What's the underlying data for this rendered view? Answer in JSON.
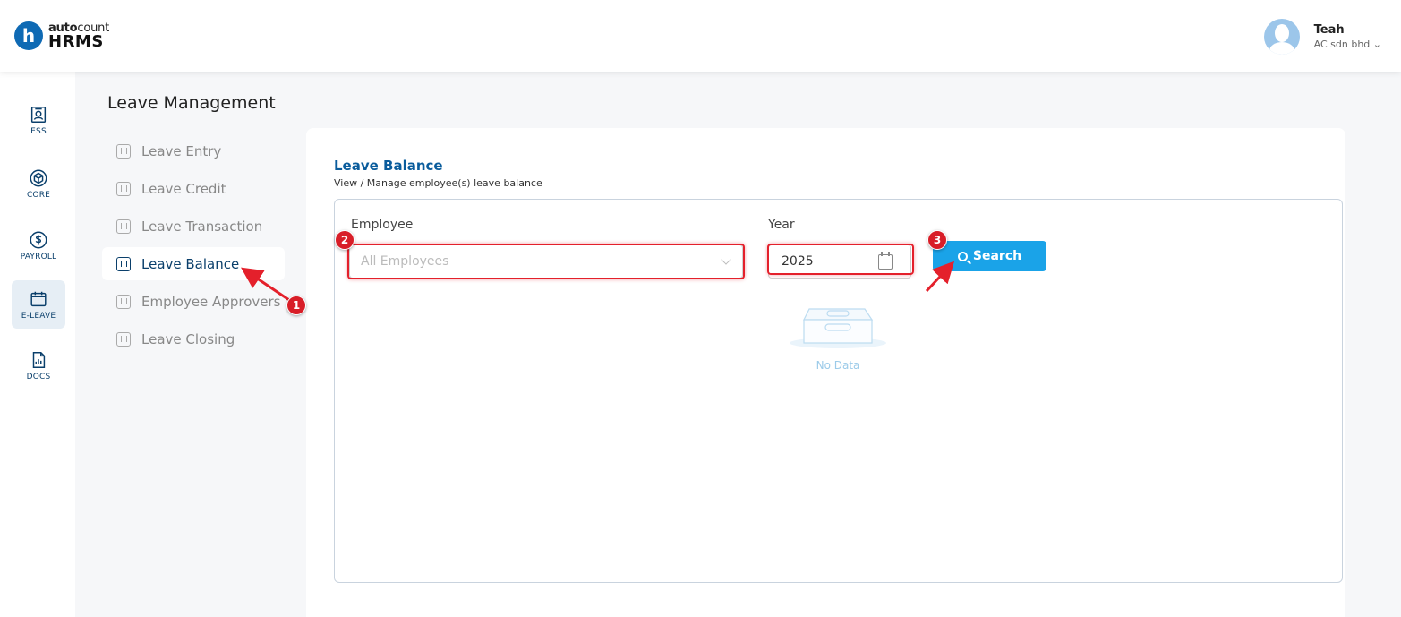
{
  "header": {
    "logo_letter": "h",
    "brand_prefix": "auto",
    "brand_suffix": "count",
    "product": "HRMS",
    "user_name": "Teah",
    "user_company": "AC sdn bhd ⌄"
  },
  "rail": [
    {
      "label": "ESS",
      "icon": "badge-icon"
    },
    {
      "label": "CORE",
      "icon": "cube-icon"
    },
    {
      "label": "PAYROLL",
      "icon": "dollar-icon"
    },
    {
      "label": "E-LEAVE",
      "icon": "calendar-icon",
      "active": true
    },
    {
      "label": "DOCS",
      "icon": "document-chart-icon"
    }
  ],
  "page_title": "Leave Management",
  "submenu": [
    {
      "label": "Leave Entry"
    },
    {
      "label": "Leave Credit"
    },
    {
      "label": "Leave Transaction"
    },
    {
      "label": "Leave Balance",
      "active": true
    },
    {
      "label": "Employee Approvers"
    },
    {
      "label": "Leave Closing"
    }
  ],
  "card": {
    "title": "Leave Balance",
    "subtitle": "View / Manage employee(s) leave balance",
    "employee_label": "Employee",
    "employee_placeholder": "All Employees",
    "year_label": "Year",
    "year_value": "2025",
    "search_label": "Search",
    "empty_label": "No Data"
  },
  "annotations": {
    "badge_1": "1",
    "badge_2": "2",
    "badge_3": "3",
    "color": "#e4202b"
  }
}
